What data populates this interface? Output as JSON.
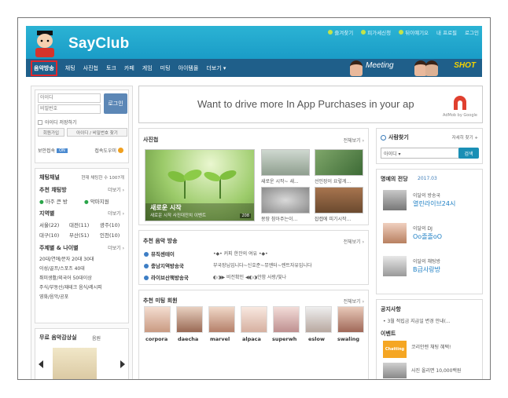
{
  "header": {
    "logo": "SayClub",
    "links": [
      "즐겨찾기",
      "피가세신청",
      "뒤이얘기오",
      "내 프로필",
      "로그인"
    ]
  },
  "nav": {
    "items": [
      "음악방송",
      "채팅",
      "사진첩",
      "토크",
      "카페",
      "게임",
      "미팅",
      "아이템몰",
      "더보기 ▾"
    ],
    "meeting": "Meeting",
    "shot": "SHOT"
  },
  "login": {
    "id_placeholder": "아이디",
    "pw_placeholder": "비밀번호",
    "login_btn": "로그인",
    "save_id": "아이디 저장하기",
    "join": "회원가입",
    "find": "아이디 / 비밀번호 찾기",
    "secure": "보안접속",
    "secure_badge": "ON",
    "help": "접속도우미"
  },
  "channel": {
    "title": "채팅채널",
    "status": "현재 채팅한 수 1007개",
    "recommend": "추천 채팅방",
    "more": "더보기 ›",
    "rec_items": [
      "아주 큰 방",
      "악마지원"
    ],
    "region": "지역별",
    "region_more": "더보기 ›",
    "regions": [
      "서울(22)",
      "대전(11)",
      "광주(10)",
      "대구(10)",
      "부산(51)",
      "인천(10)"
    ],
    "topic": "주제별 & 나이별",
    "topic_more": "더보기 ›",
    "topics": [
      "20대/연애/문자  20대  30대",
      "이성/골프/스포츠  40대",
      "취미생활/외국어  50대이상",
      "주식/부동산/재테크  음식/레시피",
      "영화/음악/공포"
    ]
  },
  "music": {
    "title": "무료 음악감상실",
    "sub": "음원"
  },
  "ad": {
    "text": "Want to drive more In App Purchases in your ap",
    "by": "AdMob by Google"
  },
  "photo": {
    "title": "사진첩",
    "more": "전체보기 ›",
    "main_title": "새로운 시작",
    "main_sub": "새로운 시작 사진대잔치 이벤트",
    "main_count": "208",
    "caps": [
      "새로운 시작~ 새...",
      "선인장이 요렇게...",
      "몽땅 참아주는이...",
      "잡캡에 피기시작..."
    ]
  },
  "broadcast": {
    "title": "추천 음악 방송",
    "more": "전체보기 ›",
    "rows": [
      {
        "name": "뮤직센테이",
        "desc": "•◆• 커피 한잔의 여유 •◆•"
      },
      {
        "name": "충남지역방송국",
        "desc": "부국장님입니다~신호준~뮤엔터~렌트자유입니다"
      },
      {
        "name": "라이브산책방송국",
        "desc": "◐◑▶ 비전확인 ◀◐◑안함 사랑/빛나"
      }
    ]
  },
  "meeting": {
    "title": "추천 미팅 회원",
    "more": "전체보기 ›",
    "members": [
      "corpora",
      "daecha",
      "marvel",
      "alpaca",
      "superwh",
      "eslow",
      "swaling"
    ]
  },
  "search": {
    "title": "사람찾기",
    "more": "자세히 찾기 +",
    "select": "아이디 ▾",
    "btn": "검색"
  },
  "ranking": {
    "title": "명예의 전당",
    "date": "2017.03",
    "items": [
      {
        "name": "이달의 방송국",
        "value": "열린라이브24시"
      },
      {
        "name": "이달의 DJ",
        "value": "Oo졸졸oO"
      },
      {
        "name": "이달의 채팅방",
        "value": "B급사랑방"
      }
    ]
  },
  "notice": {
    "title": "공지사항",
    "item": "• 3월 적립금 지급일 변경 안내(..."
  },
  "event": {
    "title": "이벤트",
    "items": [
      "코리안렌 채팅 혜택!",
      "사진 올리면 10,000백원"
    ],
    "badge": "Chatting"
  }
}
